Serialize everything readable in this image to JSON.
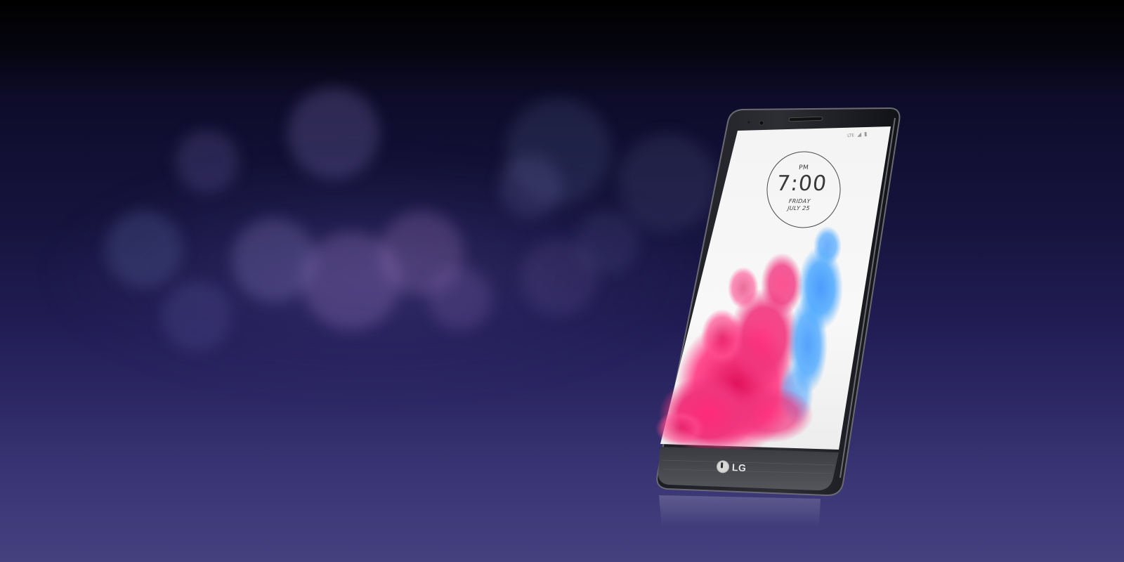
{
  "scene": {
    "background_colors": {
      "top": "#000000",
      "mid": "#16143e",
      "bottom": "#45417f"
    },
    "bokeh_color": "#8a86c8"
  },
  "phone": {
    "brand": "LG",
    "body_color": "#2a2b30",
    "screen": {
      "status": "LTE",
      "clock": {
        "ampm": "PM",
        "time": "7:00",
        "day": "FRIDAY",
        "date": "JULY 25"
      },
      "wallpaper_colors": [
        "#ff2d7a",
        "#e01a5e",
        "#2f9bff",
        "#ffffff"
      ]
    }
  }
}
